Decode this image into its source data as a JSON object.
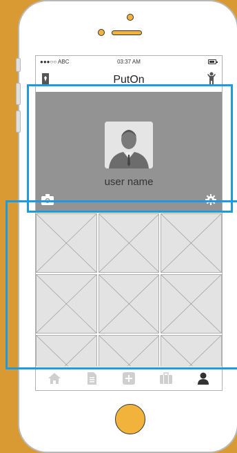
{
  "status_bar": {
    "carrier": "●●●○○ ABC",
    "time": "03:37 AM",
    "battery_icon": "battery-icon"
  },
  "nav_bar": {
    "title": "PutOn",
    "left_icon": "tie-icon",
    "right_icon": "person-icon"
  },
  "profile": {
    "user_name": "user name",
    "avatar_icon": "avatar-icon",
    "camera_icon": "camera-icon",
    "settings_icon": "gear-icon"
  },
  "grid": {
    "cell_count": 9
  },
  "tab_bar": {
    "items": [
      {
        "icon": "home-icon"
      },
      {
        "icon": "document-icon"
      },
      {
        "icon": "add-icon"
      },
      {
        "icon": "briefcase-icon"
      },
      {
        "icon": "user-icon",
        "active": true
      }
    ]
  },
  "colors": {
    "background": "#D99A33",
    "profile_bg": "#939393",
    "highlight": "#1E9BE0",
    "grid_cell": "#E3E3E3"
  }
}
